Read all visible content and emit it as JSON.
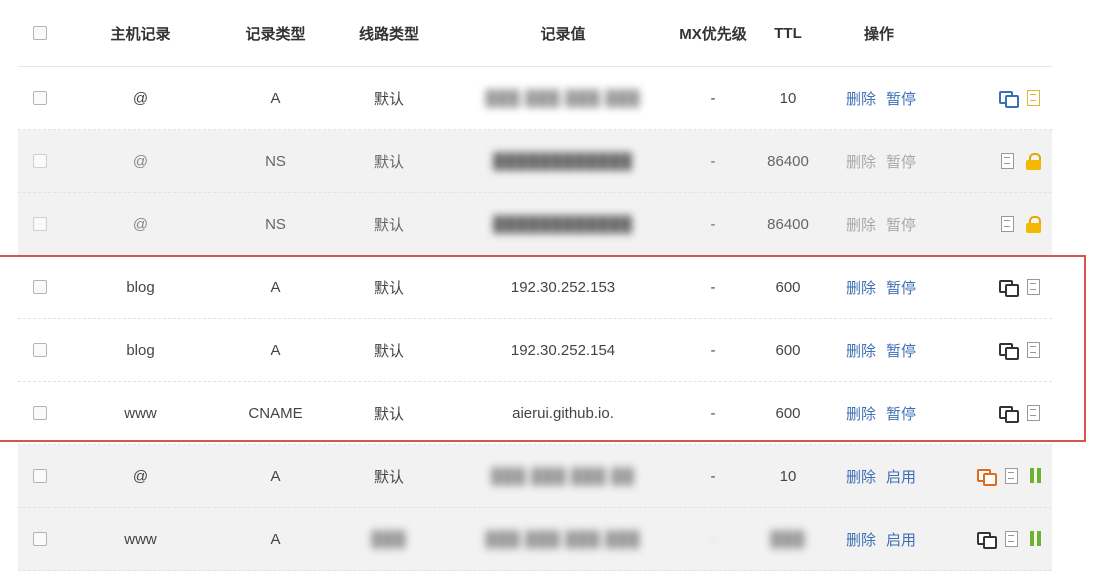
{
  "headers": {
    "host": "主机记录",
    "type": "记录类型",
    "line": "线路类型",
    "value": "记录值",
    "mx": "MX优先级",
    "ttl": "TTL",
    "ops": "操作"
  },
  "rows": [
    {
      "host": "@",
      "type": "A",
      "line": "默认",
      "value": "███.███.███.███",
      "mx": "-",
      "ttl": "10",
      "delete": "删除",
      "action": "暂停"
    },
    {
      "host": "@",
      "type": "NS",
      "line": "默认",
      "value": "████████████",
      "mx": "-",
      "ttl": "86400",
      "delete": "删除",
      "action": "暂停"
    },
    {
      "host": "@",
      "type": "NS",
      "line": "默认",
      "value": "████████████",
      "mx": "-",
      "ttl": "86400",
      "delete": "删除",
      "action": "暂停"
    },
    {
      "host": "blog",
      "type": "A",
      "line": "默认",
      "value": "192.30.252.153",
      "mx": "-",
      "ttl": "600",
      "delete": "删除",
      "action": "暂停"
    },
    {
      "host": "blog",
      "type": "A",
      "line": "默认",
      "value": "192.30.252.154",
      "mx": "-",
      "ttl": "600",
      "delete": "删除",
      "action": "暂停"
    },
    {
      "host": "www",
      "type": "CNAME",
      "line": "默认",
      "value": "aierui.github.io.",
      "mx": "-",
      "ttl": "600",
      "delete": "删除",
      "action": "暂停"
    },
    {
      "host": "@",
      "type": "A",
      "line": "默认",
      "value": "███.███.███.██",
      "mx": "-",
      "ttl": "10",
      "delete": "删除",
      "action": "启用"
    },
    {
      "host": "www",
      "type": "A",
      "line": "███",
      "value": "███.███.███.███",
      "mx": "-",
      "ttl": "███",
      "delete": "删除",
      "action": "启用"
    }
  ],
  "colors": {
    "link": "#3d6fb6",
    "highlight_border": "#d9534f",
    "copy_orange": "#e06c1a",
    "note_yellow": "#e3b43a",
    "pause_green": "#6cb22c"
  },
  "icons": [
    "checkbox",
    "copy-icon",
    "note-icon",
    "lock-icon",
    "pause-icon"
  ]
}
